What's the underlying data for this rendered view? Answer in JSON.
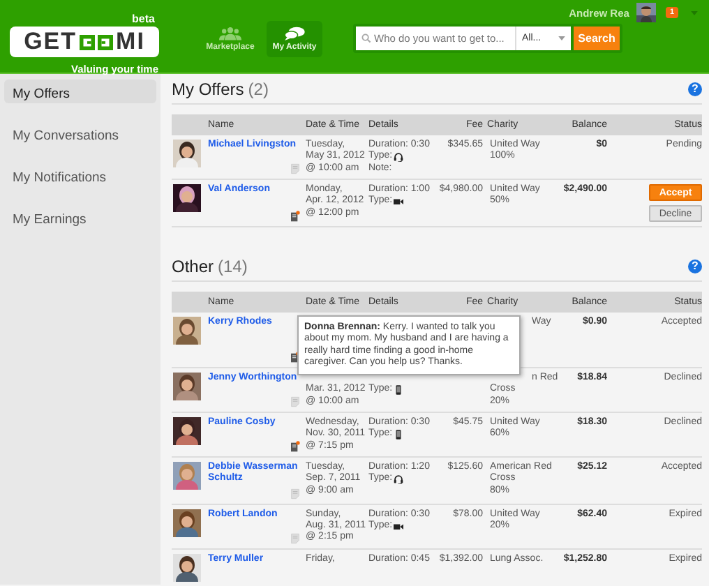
{
  "header": {
    "logo": {
      "left": "GET",
      "right": "MI",
      "badge": "beta",
      "tagline": "Valuing your time"
    },
    "nav": [
      {
        "label": "Marketplace",
        "selected": false
      },
      {
        "label": "My Activity",
        "selected": true
      }
    ],
    "search": {
      "placeholder": "Who do you want to get to...",
      "scope": "All...",
      "button": "Search"
    },
    "user": {
      "name": "Andrew Rea",
      "notifications": "1"
    }
  },
  "sidebar": {
    "items": [
      {
        "label": "My Offers",
        "selected": true
      },
      {
        "label": "My Conversations",
        "selected": false
      },
      {
        "label": "My Notifications",
        "selected": false
      },
      {
        "label": "My Earnings",
        "selected": false
      }
    ]
  },
  "sections": [
    {
      "title": "My Offers",
      "count": "(2)",
      "help": "?",
      "columns": [
        "Name",
        "Date & Time",
        "Details",
        "Fee",
        "Charity",
        "Balance",
        "Status"
      ],
      "rows": [
        {
          "name": "Michael Livingston",
          "unread": false,
          "date": [
            "Tuesday,",
            "May 31, 2012",
            "@ 10:00 am"
          ],
          "details": {
            "duration": "Duration: 0:30",
            "type_label": "Type:",
            "kind": "headset",
            "note": "Note:"
          },
          "fee": "$345.65",
          "charity": [
            "United Way",
            "100%"
          ],
          "balance": "$0",
          "status": "Pending"
        },
        {
          "name": "Val Anderson",
          "unread": true,
          "date": [
            "Monday,",
            "Apr. 12, 2012",
            "@ 12:00 pm"
          ],
          "details": {
            "duration": "Duration: 1:00",
            "type_label": "Type:",
            "kind": "video"
          },
          "fee": "$4,980.00",
          "charity": [
            "United Way",
            "50%"
          ],
          "balance": "$2,490.00",
          "actions": [
            {
              "label": "Accept",
              "kind": "accept"
            },
            {
              "label": "Decline",
              "kind": "decline"
            }
          ]
        }
      ]
    },
    {
      "title": "Other",
      "count": "(14)",
      "help": "?",
      "columns": [
        "Name",
        "Date & Time",
        "Details",
        "Fee",
        "Charity",
        "Balance",
        "Status"
      ],
      "tooltip": "**Donna Brennan:** Kerry. I wanted to talk you about my mom. My husband and I are having a really hard time finding a good in-home caregiver. Can you help us? Thanks.",
      "rows": [
        {
          "name": "Kerry Rhodes",
          "unread": true,
          "charity": [
            "Way"
          ],
          "balance": "$0.90",
          "status": "Accepted"
        },
        {
          "name": "Jenny Worthington",
          "unread": false,
          "date": [
            "Mar. 31, 2012",
            "@ 10:00 am"
          ],
          "details": {
            "type_label": "Type:",
            "kind": "phone"
          },
          "charity": [
            "n Red",
            "Cross",
            "20%"
          ],
          "balance": "$18.84",
          "status": "Declined"
        },
        {
          "name": "Pauline Cosby",
          "unread": true,
          "date": [
            "Wednesday,",
            "Nov. 30, 2011",
            "@ 7:15 pm"
          ],
          "details": {
            "duration": "Duration: 0:30",
            "type_label": "Type:",
            "kind": "phone"
          },
          "fee": "$45.75",
          "charity": [
            "United Way",
            "60%"
          ],
          "balance": "$18.30",
          "status": "Declined"
        },
        {
          "name": "Debbie Wasserman Schultz",
          "unread": false,
          "date": [
            "Tuesday,",
            "Sep. 7, 2011",
            "@ 9:00 am"
          ],
          "details": {
            "duration": "Duration: 1:20",
            "type_label": "Type:",
            "kind": "headset"
          },
          "fee": "$125.60",
          "charity": [
            "American Red",
            "Cross",
            "80%"
          ],
          "balance": "$25.12",
          "status": "Accepted"
        },
        {
          "name": "Robert Landon",
          "unread": false,
          "date": [
            "Sunday,",
            "Aug. 31, 2011",
            "@ 2:15 pm"
          ],
          "details": {
            "duration": "Duration: 0:30",
            "type_label": "Type:",
            "kind": "video"
          },
          "fee": "$78.00",
          "charity": [
            "United Way",
            "20%"
          ],
          "balance": "$62.40",
          "status": "Expired"
        },
        {
          "name": "Terry Muller",
          "date": [
            "Friday,"
          ],
          "details": {
            "duration": "Duration: 0:45"
          },
          "fee": "$1,392.00",
          "charity": [
            "Lung Assoc."
          ],
          "balance": "$1,252.80",
          "status": "Expired"
        }
      ]
    }
  ]
}
